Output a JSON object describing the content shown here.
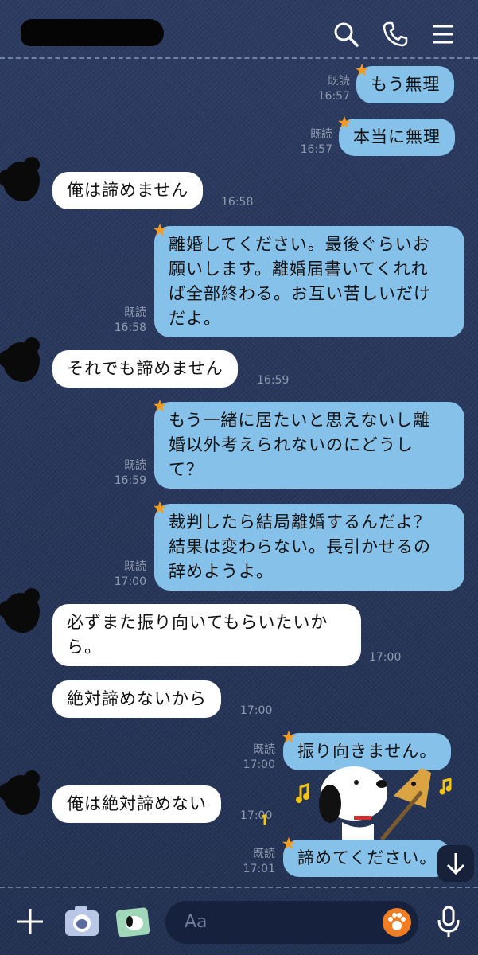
{
  "header": {
    "search_icon": "search-icon",
    "call_icon": "phone-icon",
    "menu_icon": "menu-icon"
  },
  "messages": {
    "m1": {
      "text": "もう無理",
      "read": "既読",
      "time": "16:57"
    },
    "m2": {
      "text": "本当に無理",
      "read": "既読",
      "time": "16:57"
    },
    "m3": {
      "text": "俺は諦めません",
      "time": "16:58"
    },
    "m4": {
      "text": "離婚してください。最後ぐらいお\n願いします。離婚届書いてくれれ\nば全部終わる。お互い苦しいだけ\nだよ。",
      "read": "既読",
      "time": "16:58"
    },
    "m5": {
      "text": "それでも諦めません",
      "time": "16:59"
    },
    "m6": {
      "text": "もう一緒に居たいと思えないし離\n婚以外考えられないのにどうし\nて？",
      "read": "既読",
      "time": "16:59"
    },
    "m7": {
      "text": "裁判したら結局離婚するんだよ？\n結果は変わらない。長引かせるの\n辞めようよ。",
      "read": "既読",
      "time": "17:00"
    },
    "m8": {
      "text": "必ずまた振り向いてもらいたいか\nら。",
      "time": "17:00"
    },
    "m9": {
      "text": "絶対諦めないから",
      "time": "17:00"
    },
    "m10": {
      "text": "振り向きません。",
      "read": "既読",
      "time": "17:00"
    },
    "m11": {
      "text": "俺は絶対諦めない",
      "time": "17:00"
    },
    "m12": {
      "text": "諦めてください。",
      "read": "既読",
      "time": "17:01"
    }
  },
  "input": {
    "placeholder": "Aa"
  },
  "colors": {
    "outgoing_bubble": "#86c1ea",
    "incoming_bubble": "#ffffff",
    "background": "#27365a"
  }
}
